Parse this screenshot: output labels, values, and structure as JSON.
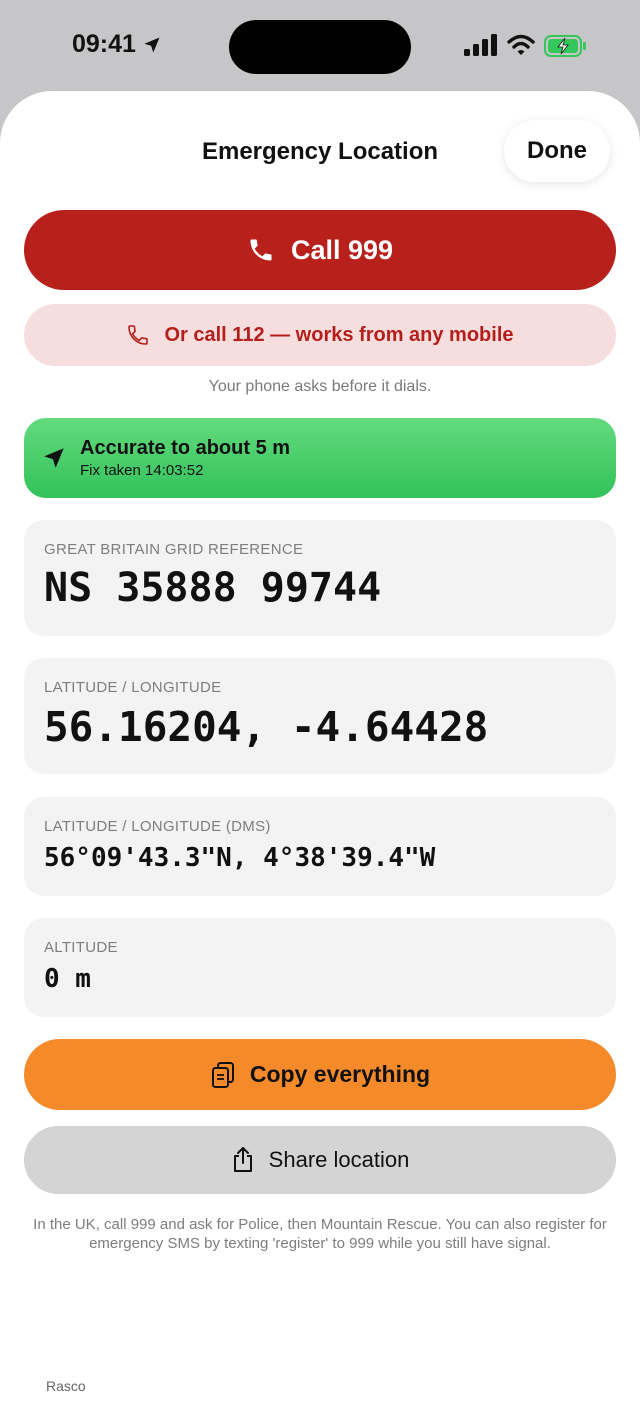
{
  "status_bar": {
    "time": "09:41",
    "icons": [
      "location-arrow-icon",
      "cellular-signal-icon",
      "wifi-icon",
      "battery-charging-icon"
    ]
  },
  "sheet": {
    "title": "Emergency Location",
    "done_label": "Done",
    "peek_text": "Rasco"
  },
  "actions": {
    "call_primary_label": "Call 999",
    "call_secondary_label": "Or call 112 — works from any mobile",
    "dial_note": "Your phone asks before it dials.",
    "copy_label": "Copy everything",
    "share_label": "Share location"
  },
  "accuracy": {
    "title": "Accurate to about 5 m",
    "subtitle": "Fix taken 14:03:52"
  },
  "cards": {
    "grid_ref": {
      "label": "GREAT BRITAIN GRID REFERENCE",
      "value": "NS 35888 99744"
    },
    "lat_lon": {
      "label": "LATITUDE / LONGITUDE",
      "value": "56.16204, -4.64428"
    },
    "dms": {
      "label": "LATITUDE / LONGITUDE (DMS)",
      "value": "56°09'43.3\"N, 4°38'39.4\"W"
    },
    "altitude": {
      "label": "ALTITUDE",
      "value": "0 m"
    }
  },
  "footer_note": "In the UK, call 999 and ask for Police, then Mountain Rescue. You can also register for emergency SMS by texting 'register' to 999 while you still have signal.",
  "colors": {
    "call_red": "#b8201c",
    "call112_bg": "#f7dede",
    "call112_text": "#b41f1b",
    "accuracy_green": "#33c25a",
    "copy_orange": "#f58a2b",
    "share_gray": "#d4d4d4",
    "card_bg": "#f3f3f3"
  }
}
